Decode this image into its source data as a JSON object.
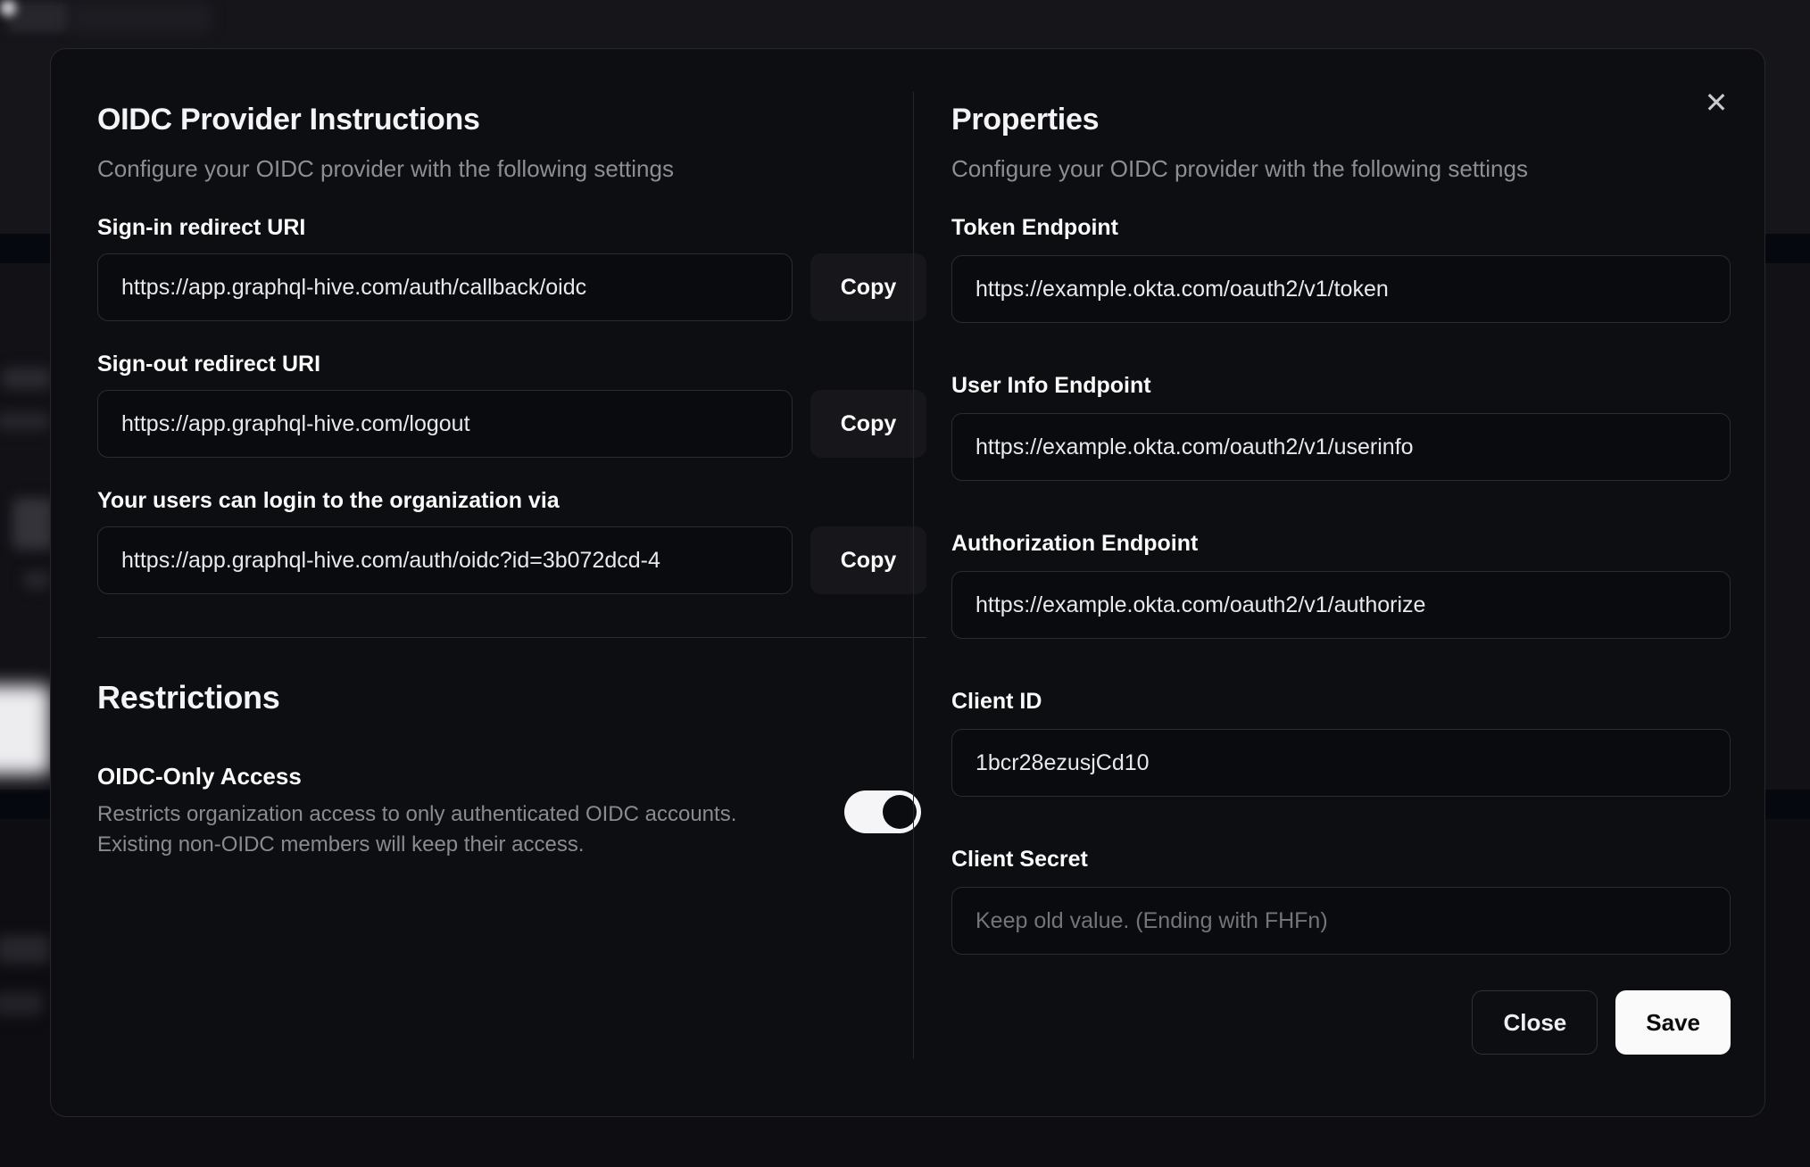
{
  "dialog": {
    "close_icon": "✕",
    "left": {
      "title": "OIDC Provider Instructions",
      "subtitle": "Configure your OIDC provider with the following settings",
      "fields": [
        {
          "label": "Sign-in redirect URI",
          "value": "https://app.graphql-hive.com/auth/callback/oidc",
          "button": "Copy"
        },
        {
          "label": "Sign-out redirect URI",
          "value": "https://app.graphql-hive.com/logout",
          "button": "Copy"
        },
        {
          "label": "Your users can login to the organization via",
          "value": "https://app.graphql-hive.com/auth/oidc?id=3b072dcd-4",
          "button": "Copy"
        }
      ],
      "restrictions": {
        "title": "Restrictions",
        "toggle_label": "OIDC-Only Access",
        "description_line1": "Restricts organization access to only authenticated OIDC accounts.",
        "description_line2": "Existing non-OIDC members will keep their access.",
        "toggle_state": "on"
      }
    },
    "right": {
      "title": "Properties",
      "subtitle": "Configure your OIDC provider with the following settings",
      "fields": [
        {
          "label": "Token Endpoint",
          "value": "https://example.okta.com/oauth2/v1/token"
        },
        {
          "label": "User Info Endpoint",
          "value": "https://example.okta.com/oauth2/v1/userinfo"
        },
        {
          "label": "Authorization Endpoint",
          "value": "https://example.okta.com/oauth2/v1/authorize"
        },
        {
          "label": "Client ID",
          "value": "1bcr28ezusjCd10"
        },
        {
          "label": "Client Secret",
          "value": "",
          "placeholder": "Keep old value. (Ending with FHFn)"
        }
      ],
      "buttons": {
        "close": "Close",
        "save": "Save"
      }
    },
    "colors": {
      "modal_background": "#0d0e12",
      "input_border": "#2d2c2c",
      "primary_button_background": "#fafafa",
      "toggle_on_track": "#f5f5f7",
      "toggle_thumb": "#0b0c10"
    }
  }
}
